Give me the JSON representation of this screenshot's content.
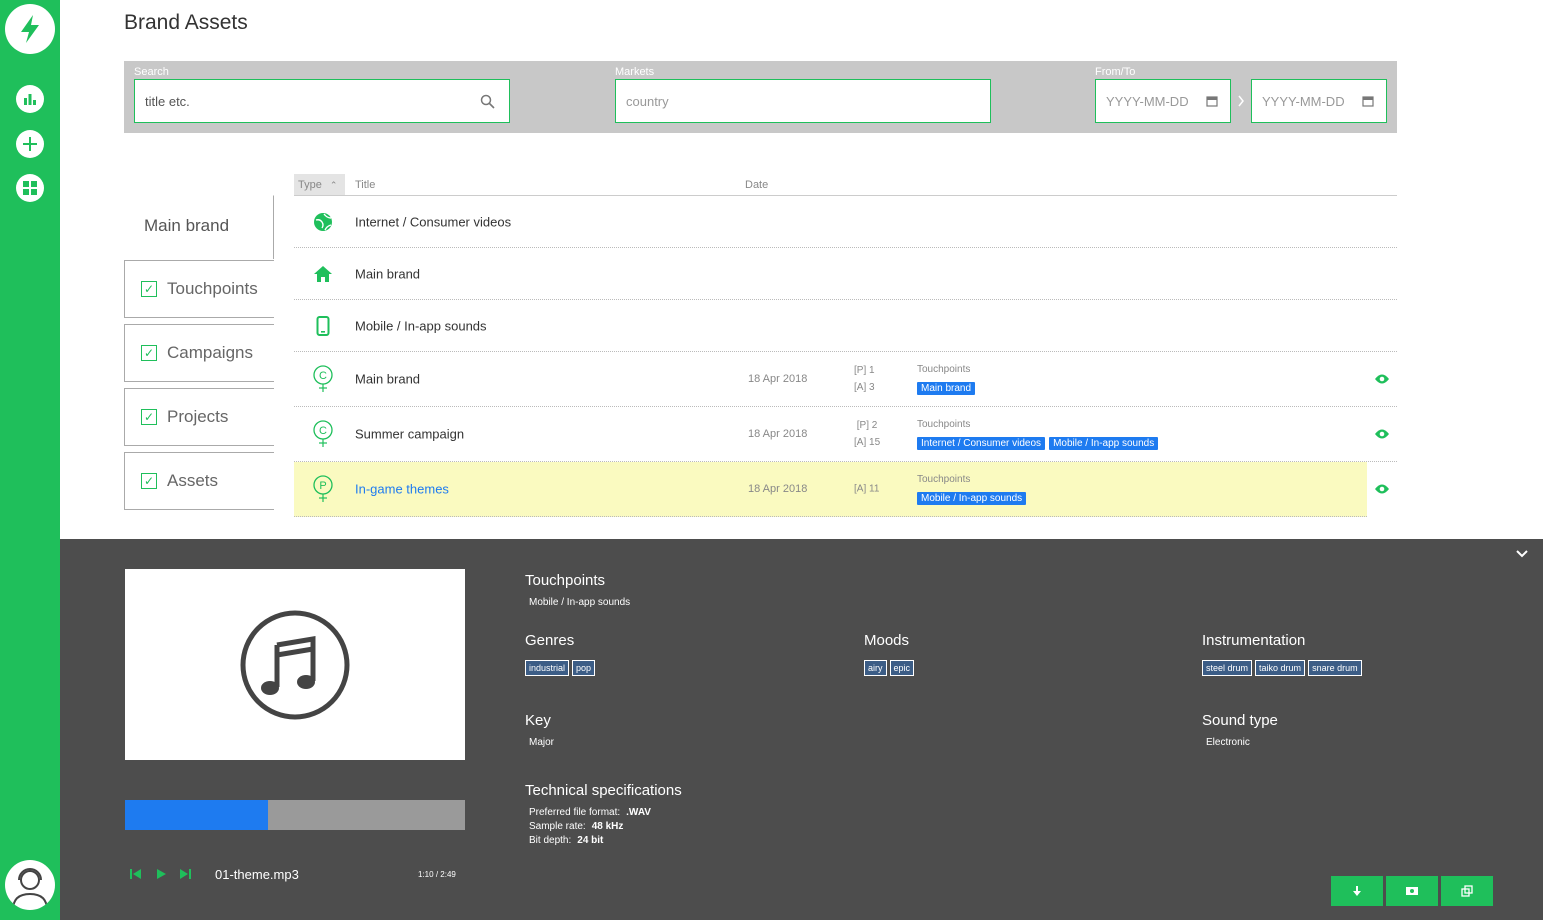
{
  "page": {
    "title": "Brand Assets"
  },
  "filters": {
    "search": {
      "label": "Search",
      "value": "title etc."
    },
    "markets": {
      "label": "Markets",
      "placeholder": "country"
    },
    "daterange": {
      "label": "From/To",
      "from_placeholder": "YYYY-MM-DD",
      "to_placeholder": "YYYY-MM-DD"
    }
  },
  "tabs": {
    "main": "Main brand",
    "items": [
      {
        "label": "Touchpoints",
        "checked": true
      },
      {
        "label": "Campaigns",
        "checked": true
      },
      {
        "label": "Projects",
        "checked": true
      },
      {
        "label": "Assets",
        "checked": true
      }
    ]
  },
  "table": {
    "columns": {
      "type": "Type",
      "title": "Title",
      "date": "Date"
    },
    "rows": [
      {
        "icon": "globe-icon",
        "title": "Internet / Consumer videos"
      },
      {
        "icon": "home-icon",
        "title": "Main brand"
      },
      {
        "icon": "mobile-icon",
        "title": "Mobile / In-app sounds"
      },
      {
        "icon": "campaign-icon",
        "title": "Main brand",
        "date": "18 Apr 2018",
        "p_count": "[P] 1",
        "a_count": "[A] 3",
        "tags_label": "Touchpoints",
        "tags": [
          "Main brand"
        ]
      },
      {
        "icon": "campaign-icon",
        "title": "Summer campaign",
        "date": "18 Apr 2018",
        "p_count": "[P] 2",
        "a_count": "[A] 15",
        "tags_label": "Touchpoints",
        "tags": [
          "Internet / Consumer videos",
          "Mobile / In-app sounds"
        ]
      },
      {
        "icon": "project-icon",
        "title": "In-game themes",
        "date": "18 Apr 2018",
        "p_count": "",
        "a_count": "[A] 11",
        "tags_label": "Touchpoints",
        "tags": [
          "Mobile / In-app sounds"
        ]
      }
    ]
  },
  "player": {
    "track": "01-theme.mp3",
    "time_current": "1:10",
    "time_total": "2:49",
    "progress_fraction": 0.42,
    "touchpoints": {
      "title": "Touchpoints",
      "value": "Mobile / In-app sounds"
    },
    "genres": {
      "title": "Genres",
      "tags": [
        "industrial",
        "pop"
      ]
    },
    "moods": {
      "title": "Moods",
      "tags": [
        "airy",
        "epic"
      ]
    },
    "instrumentation": {
      "title": "Instrumentation",
      "tags": [
        "steel drum",
        "taiko drum",
        "snare drum"
      ]
    },
    "key": {
      "title": "Key",
      "value": "Major"
    },
    "sound_type": {
      "title": "Sound type",
      "value": "Electronic"
    },
    "tech": {
      "title": "Technical specifications",
      "format_label": "Preferred file format:",
      "format_value": ".WAV",
      "rate_label": "Sample rate:",
      "rate_value": "48 kHz",
      "depth_label": "Bit depth:",
      "depth_value": "24 bit"
    }
  },
  "colors": {
    "brand": "#1fbf5b",
    "accent": "#1e7bf0",
    "highlight": "#fafac0",
    "filter_bg": "#c8c8c8"
  }
}
